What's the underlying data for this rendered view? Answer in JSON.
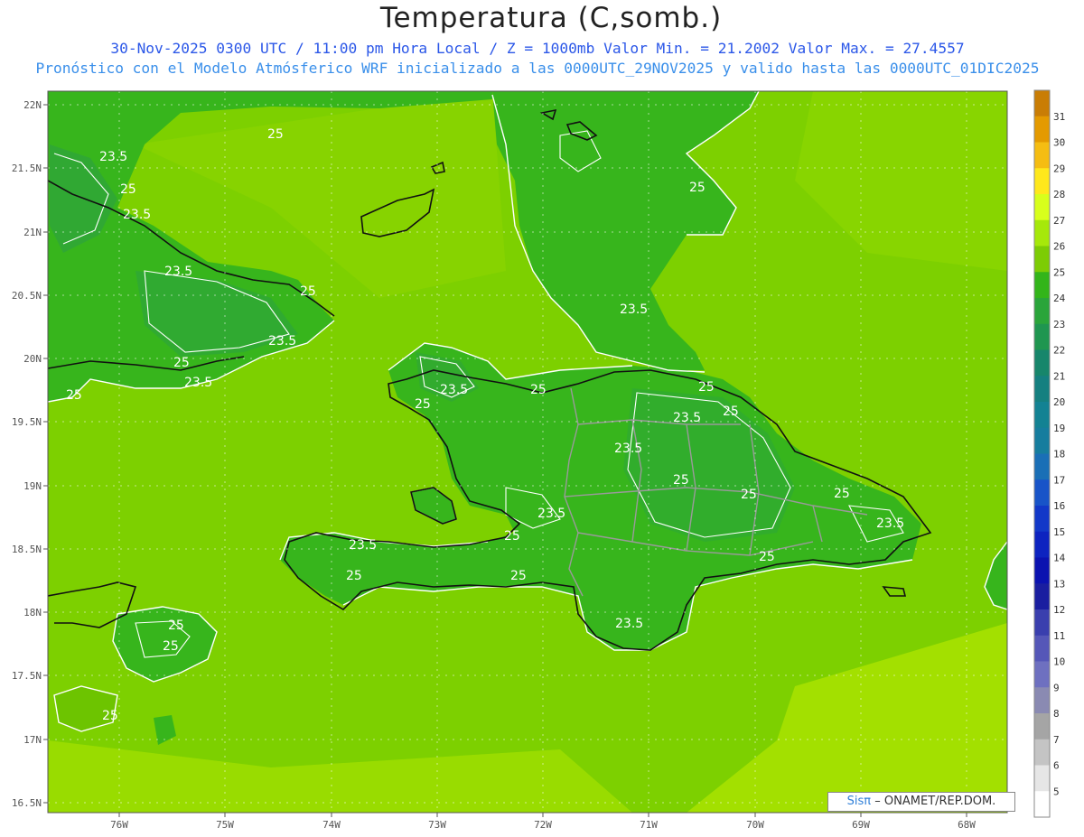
{
  "header": {
    "title": "Temperatura (C,somb.)",
    "subtitle_line1": "30-Nov-2025 0300 UTC / 11:00 pm Hora Local / Z = 1000mb  Valor Min. = 21.2002  Valor Max. = 27.4557",
    "subtitle_line2": "Pronóstico con el Modelo Atmósferico WRF inicializado a las 0000UTC_29NOV2025 y valido hasta las  0000UTC_01DIC2025"
  },
  "axes": {
    "lat_labels": [
      "22N",
      "21.5N",
      "21N",
      "20.5N",
      "20N",
      "19.5N",
      "19N",
      "18.5N",
      "18N",
      "17.5N",
      "17N",
      "16.5N"
    ],
    "lon_labels": [
      "76W",
      "75W",
      "74W",
      "73W",
      "72W",
      "71W",
      "70W",
      "69W",
      "68W"
    ]
  },
  "colorbar": {
    "labels": [
      "31",
      "30",
      "29",
      "28",
      "27",
      "26",
      "25",
      "24",
      "23",
      "22",
      "21",
      "20",
      "19",
      "18",
      "17",
      "16",
      "15",
      "14",
      "13",
      "12",
      "11",
      "10",
      "9",
      "8",
      "7",
      "6",
      "5"
    ],
    "colors": [
      "#c97d05",
      "#e49a00",
      "#f5bd12",
      "#ffe81c",
      "#d8ff1c",
      "#a6e80a",
      "#7dcc05",
      "#33b51a",
      "#2aa53a",
      "#1f9650",
      "#17866b",
      "#158080",
      "#138293",
      "#167d9e",
      "#1a6fb6",
      "#1854c8",
      "#1238c8",
      "#0d23c0",
      "#0b12b0",
      "#1a1ea0",
      "#3a3fae",
      "#5557b8",
      "#6e70c0",
      "#8a8ab2",
      "#a5a5a5",
      "#c4c4c4",
      "#e6e6e6",
      "#ffffff"
    ]
  },
  "contour_labels": [
    "25",
    "23.5",
    "25",
    "23.5",
    "23.5",
    "25",
    "23.5",
    "25",
    "23.5",
    "25",
    "25",
    "25",
    "23.5",
    "25",
    "23.5",
    "25",
    "23.5",
    "25",
    "25",
    "25",
    "23.5",
    "23.5",
    "25",
    "23.5",
    "25",
    "25",
    "25",
    "23.5",
    "25",
    "25",
    "25",
    "23.5",
    "25"
  ],
  "credit": {
    "sis": "Sisπ",
    "text": "– ONAMET/REP.DOM."
  },
  "map_colors": {
    "light_green": "#a3e000",
    "mid_green": "#7dd000",
    "dark_green": "#37b51c",
    "darker_green": "#2ea53a",
    "coast": "#111111",
    "border": "#9a9a9a",
    "contour": "#ffffff"
  }
}
